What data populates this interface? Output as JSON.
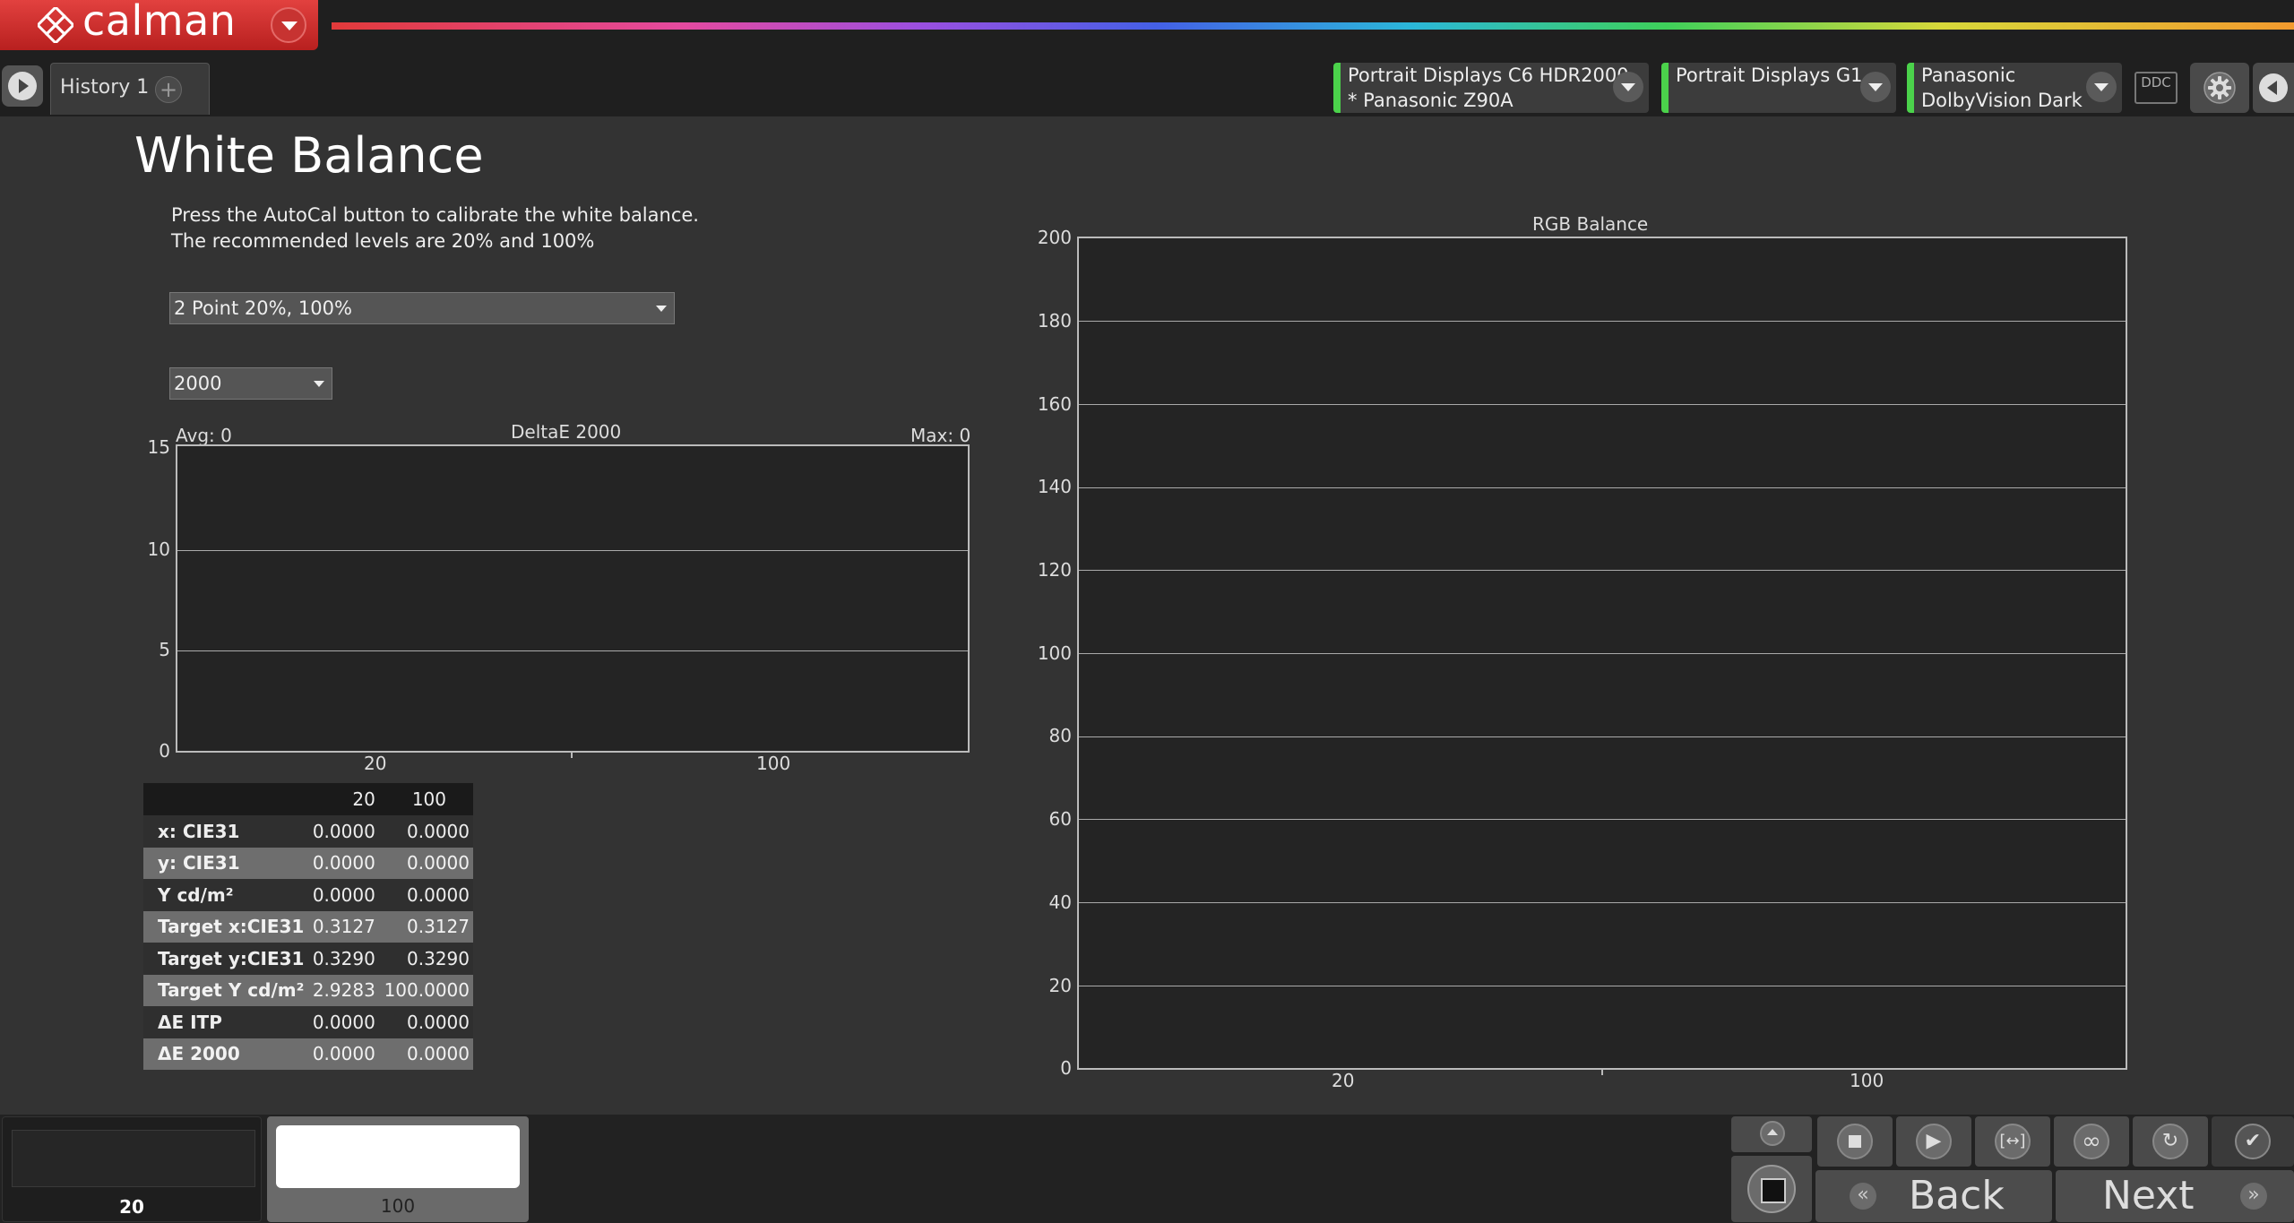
{
  "app": {
    "logo_text": "calman",
    "history_tab": "History 1",
    "add_tab_symbol": "+"
  },
  "devices": [
    {
      "line1": "Portrait Displays C6 HDR2000",
      "line2": "* Panasonic Z90A"
    },
    {
      "line1": "Portrait Displays G1",
      "line2": ""
    },
    {
      "line1": "Panasonic",
      "line2": "DolbyVision Dark"
    }
  ],
  "ddc_label": "DDC",
  "page": {
    "title": "White Balance",
    "instruction_line1": "Press the AutoCal button to calibrate the white balance.",
    "instruction_line2": "The recommended levels are 20% and 100%",
    "points_select": "2 Point 20%, 100%",
    "de_select": "2000"
  },
  "delta_chart": {
    "title": "DeltaE 2000",
    "avg_label": "Avg: 0",
    "max_label": "Max: 0",
    "y_ticks": [
      "15",
      "10",
      "5",
      "0"
    ],
    "x_labels": [
      "20",
      "100"
    ]
  },
  "rgb_chart": {
    "title": "RGB Balance",
    "y_ticks": [
      "200",
      "180",
      "160",
      "140",
      "120",
      "100",
      "80",
      "60",
      "40",
      "20",
      "0"
    ],
    "x_labels": [
      "20",
      "100"
    ]
  },
  "chart_data": [
    {
      "type": "bar",
      "title": "DeltaE 2000",
      "categories": [
        "20",
        "100"
      ],
      "values": [
        0,
        0
      ],
      "ylim": [
        0,
        15
      ],
      "grid": true,
      "annotations": [
        "Avg: 0",
        "Max: 0"
      ]
    },
    {
      "type": "bar",
      "title": "RGB Balance",
      "categories": [
        "20",
        "100"
      ],
      "series": [],
      "ylim": [
        0,
        200
      ],
      "grid": true
    }
  ],
  "table": {
    "columns": [
      "",
      "20",
      "100"
    ],
    "rows": [
      {
        "label": "x: CIE31",
        "v20": "0.0000",
        "v100": "0.0000"
      },
      {
        "label": "y: CIE31",
        "v20": "0.0000",
        "v100": "0.0000"
      },
      {
        "label": "Y cd/m²",
        "v20": "0.0000",
        "v100": "0.0000"
      },
      {
        "label": "Target x:CIE31",
        "v20": "0.3127",
        "v100": "0.3127"
      },
      {
        "label": "Target y:CIE31",
        "v20": "0.3290",
        "v100": "0.3290"
      },
      {
        "label": "Target Y cd/m²",
        "v20": "2.9283",
        "v100": "100.0000"
      },
      {
        "label": "ΔE ITP",
        "v20": "0.0000",
        "v100": "0.0000"
      },
      {
        "label": "ΔE 2000",
        "v20": "0.0000",
        "v100": "0.0000"
      }
    ]
  },
  "patches": [
    {
      "label": "20",
      "color": "#262626"
    },
    {
      "label": "100",
      "color": "#ffffff"
    }
  ],
  "nav": {
    "back": "Back",
    "next": "Next"
  },
  "colors": {
    "accent_red": "#d03533",
    "device_indicator": "#4bd24b"
  }
}
